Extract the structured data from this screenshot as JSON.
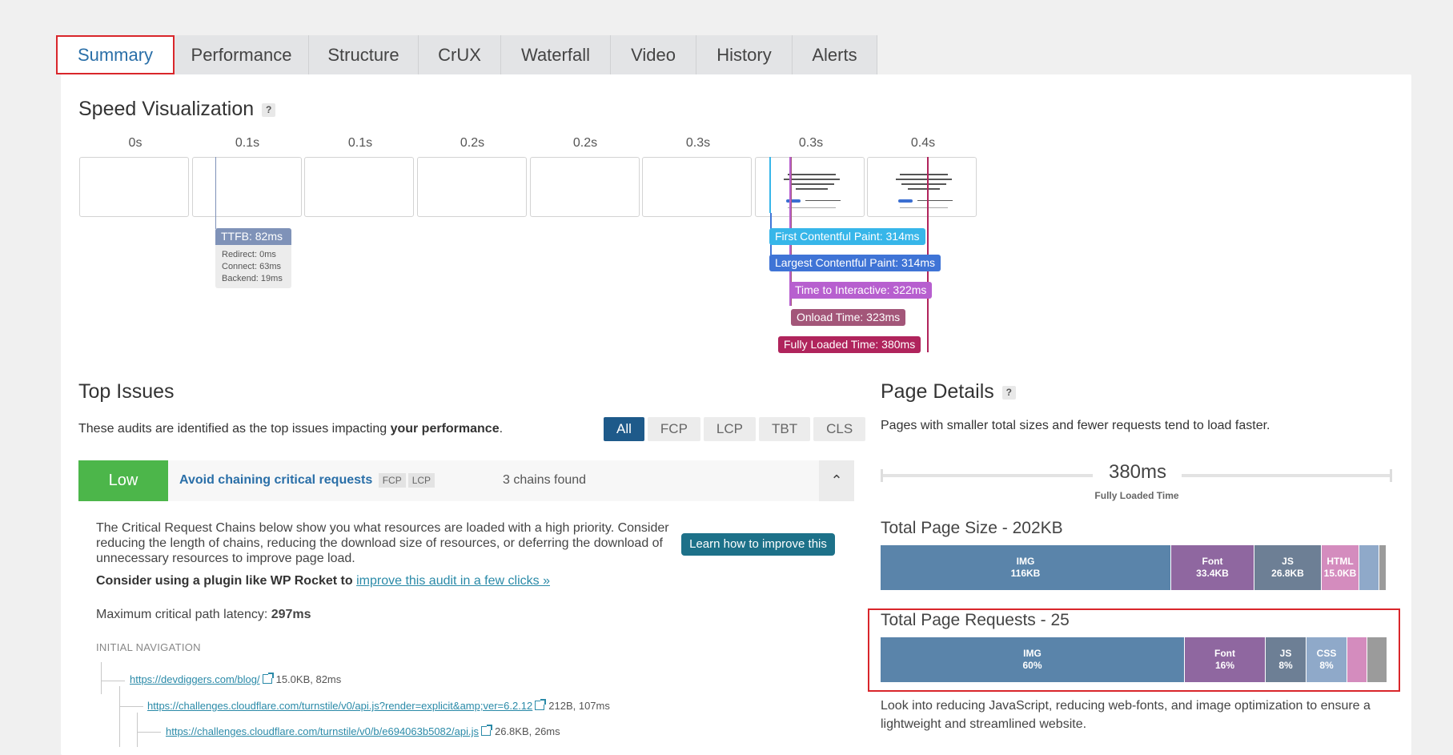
{
  "tabs": [
    {
      "label": "Summary",
      "active": true
    },
    {
      "label": "Performance"
    },
    {
      "label": "Structure"
    },
    {
      "label": "CrUX"
    },
    {
      "label": "Waterfall"
    },
    {
      "label": "Video"
    },
    {
      "label": "History"
    },
    {
      "label": "Alerts"
    }
  ],
  "speed": {
    "title": "Speed Visualization",
    "help": "?",
    "frame_times": [
      "0s",
      "0.1s",
      "0.1s",
      "0.2s",
      "0.2s",
      "0.3s",
      "0.3s",
      "0.4s"
    ],
    "ttfb": {
      "label": "TTFB: 82ms",
      "rows": [
        "Redirect: 0ms",
        "Connect: 63ms",
        "Backend: 19ms"
      ]
    },
    "markers": [
      {
        "label": "First Contentful Paint: 314ms",
        "color": "#37b6e9"
      },
      {
        "label": "Largest Contentful Paint: 314ms",
        "color": "#3f74d6"
      },
      {
        "label": "Time to Interactive: 322ms",
        "color": "#b75fcf"
      },
      {
        "label": "Onload Time: 323ms",
        "color": "#a35679"
      },
      {
        "label": "Fully Loaded Time: 380ms",
        "color": "#b0245c"
      }
    ]
  },
  "issues": {
    "title": "Top Issues",
    "desc_prefix": "These audits are identified as the top issues impacting ",
    "desc_bold": "your performance",
    "desc_suffix": ".",
    "filters": [
      "All",
      "FCP",
      "LCP",
      "TBT",
      "CLS"
    ],
    "item": {
      "severity": "Low",
      "title": "Avoid chaining critical requests",
      "tags": [
        "FCP",
        "LCP"
      ],
      "summary": "3 chains found",
      "collapse_icon": "⌃",
      "description": "The Critical Request Chains below show you what resources are loaded with a high priority. Consider reducing the length of chains, reducing the download size of resources, or deferring the download of unnecessary resources to improve page load.",
      "learn_button": "Learn how to improve this",
      "plugin_bold": "Consider using a plugin like WP Rocket to",
      "plugin_link": "improve this audit in a few clicks »",
      "latency_label": "Maximum critical path latency: ",
      "latency_value": "297ms",
      "nav_heading": "INITIAL NAVIGATION",
      "chain": [
        {
          "url": "https://devdiggers.com/blog/",
          "meta": "15.0KB, 82ms"
        },
        {
          "url": "https://challenges.cloudflare.com/turnstile/v0/api.js?render=explicit&amp;ver=6.2.12",
          "meta": "212B, 107ms"
        },
        {
          "url": "https://challenges.cloudflare.com/turnstile/v0/b/e694063b5082/api.js",
          "meta": "26.8KB, 26ms"
        }
      ]
    }
  },
  "details": {
    "title": "Page Details",
    "help": "?",
    "subtitle": "Pages with smaller total sizes and fewer requests tend to load faster.",
    "fully_loaded_value": "380ms",
    "fully_loaded_label": "Fully Loaded Time",
    "size_title": "Total Page Size - 202KB",
    "size_segments": [
      {
        "name": "IMG",
        "value": "116KB",
        "fraction": 0.574,
        "color": "#5a84aa"
      },
      {
        "name": "Font",
        "value": "33.4KB",
        "fraction": 0.165,
        "color": "#8f67a0"
      },
      {
        "name": "JS",
        "value": "26.8KB",
        "fraction": 0.133,
        "color": "#6d7f95"
      },
      {
        "name": "HTML",
        "value": "15.0KB",
        "fraction": 0.074,
        "color": "#d48cbe"
      },
      {
        "name": "",
        "value": "",
        "fraction": 0.04,
        "color": "#8fa9c9"
      },
      {
        "name": "",
        "value": "",
        "fraction": 0.014,
        "color": "#9b9b9b"
      }
    ],
    "requests_title": "Total Page Requests - 25",
    "requests_segments": [
      {
        "name": "IMG",
        "value": "60%",
        "fraction": 0.6,
        "color": "#5a84aa"
      },
      {
        "name": "Font",
        "value": "16%",
        "fraction": 0.16,
        "color": "#8f67a0"
      },
      {
        "name": "JS",
        "value": "8%",
        "fraction": 0.08,
        "color": "#6d7f95"
      },
      {
        "name": "CSS",
        "value": "8%",
        "fraction": 0.08,
        "color": "#8fa9c9"
      },
      {
        "name": "",
        "value": "",
        "fraction": 0.04,
        "color": "#d48cbe"
      },
      {
        "name": "",
        "value": "",
        "fraction": 0.04,
        "color": "#9b9b9b"
      }
    ],
    "footer": "Look into reducing JavaScript, reducing web-fonts, and image optimization to ensure a lightweight and streamlined website."
  }
}
